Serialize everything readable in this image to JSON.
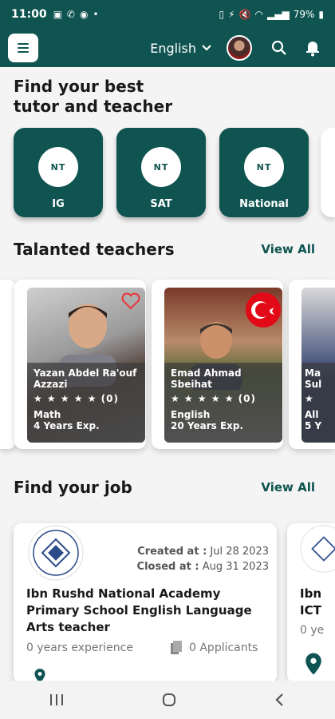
{
  "status": {
    "time": "11:00",
    "battery": "79%"
  },
  "header": {
    "language": "English"
  },
  "hero": {
    "title_line1": "Find your best",
    "title_line2": "tutor and teacher"
  },
  "categories": [
    {
      "label": "IG",
      "logo": "NT"
    },
    {
      "label": "SAT",
      "logo": "NT"
    },
    {
      "label": "National",
      "logo": "NT"
    }
  ],
  "teachers_section": {
    "title": "Talanted teachers",
    "view_all": "View All"
  },
  "teachers": [
    {
      "name_line1": "Yazan Abdel Ra'ouf",
      "name_line2": "Azzazi",
      "rating": "★ ★ ★ ★ ★ (0)",
      "subject": "Math",
      "experience": "4 Years Exp."
    },
    {
      "name_line1": "Emad  Ahmad",
      "name_line2": "Sbeihat",
      "rating": "★ ★ ★ ★ ★ (0)",
      "subject": "English",
      "experience": "20 Years Exp."
    },
    {
      "name_line1": "Ma",
      "name_line2": "Sul",
      "rating": "★",
      "subject": "All",
      "experience": "5 Y"
    }
  ],
  "jobs_section": {
    "title": "Find your job",
    "view_all": "View All"
  },
  "jobs": [
    {
      "created_label": "Created at :",
      "created_value": "Jul 28 2023",
      "closed_label": "Closed at :",
      "closed_value": "Aug 31 2023",
      "title": "Ibn Rushd National Academy Primary School English Language Arts teacher",
      "experience": "0 years experience",
      "applicants": "0 Applicants"
    },
    {
      "title_line1": "Ibn",
      "title_line2": "ICT",
      "experience": "0 ye"
    }
  ],
  "colors": {
    "primary": "#0f5451",
    "heart": "#e8343a"
  }
}
